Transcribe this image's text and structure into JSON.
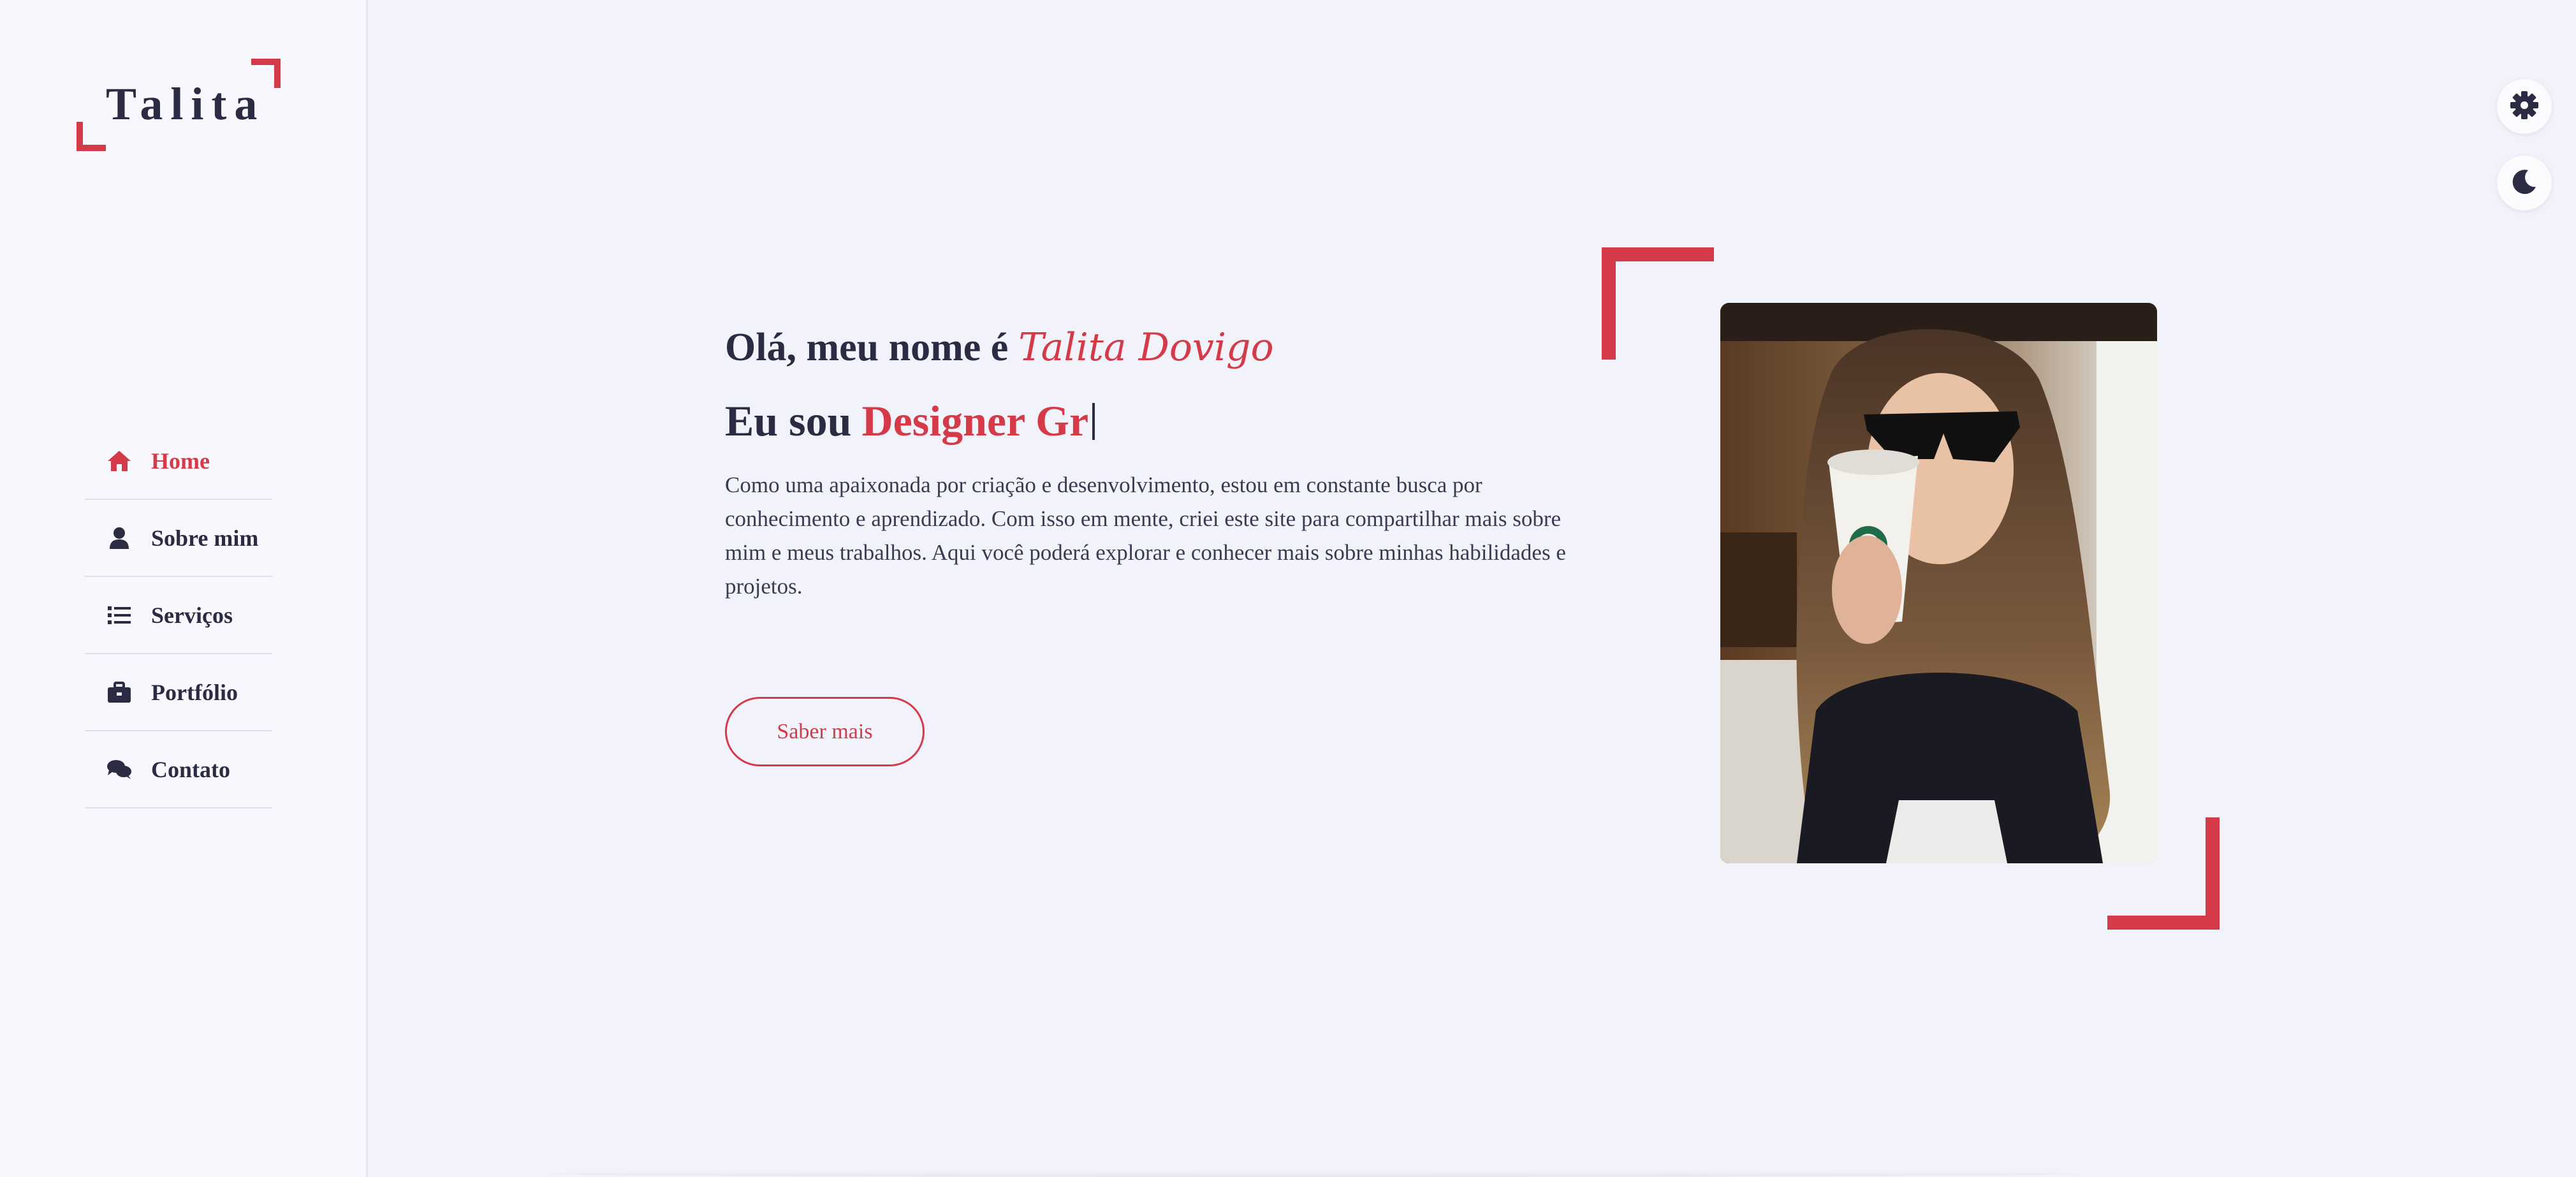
{
  "sidebar": {
    "logo_text": "Talita",
    "nav": [
      {
        "label": "Home",
        "icon": "home-icon",
        "active": true
      },
      {
        "label": "Sobre mim",
        "icon": "user-icon",
        "active": false
      },
      {
        "label": "Serviços",
        "icon": "list-icon",
        "active": false
      },
      {
        "label": "Portfólio",
        "icon": "briefcase-icon",
        "active": false
      },
      {
        "label": "Contato",
        "icon": "comments-icon",
        "active": false
      }
    ]
  },
  "controls": {
    "settings_icon": "gear-icon",
    "theme_icon": "moon-icon"
  },
  "hero": {
    "greeting": "Olá, meu nome é",
    "name": "Talita Dovigo",
    "role_prefix": "Eu sou",
    "role_highlight": "Designer Gr",
    "intro": "Como uma apaixonada por criação e desenvolvimento, estou em constante busca por conhecimento e aprendizado. Com isso em mente, criei este site para compartilhar mais sobre mim e meus trabalhos. Aqui você poderá explorar e conhecer mais sobre minhas habilidades e projetos.",
    "cta_label": "Saber mais"
  },
  "colors": {
    "accent": "#d43a47",
    "text": "#2b2c43",
    "background": "#f2f2fa",
    "sidebar": "#f8f7fd"
  }
}
